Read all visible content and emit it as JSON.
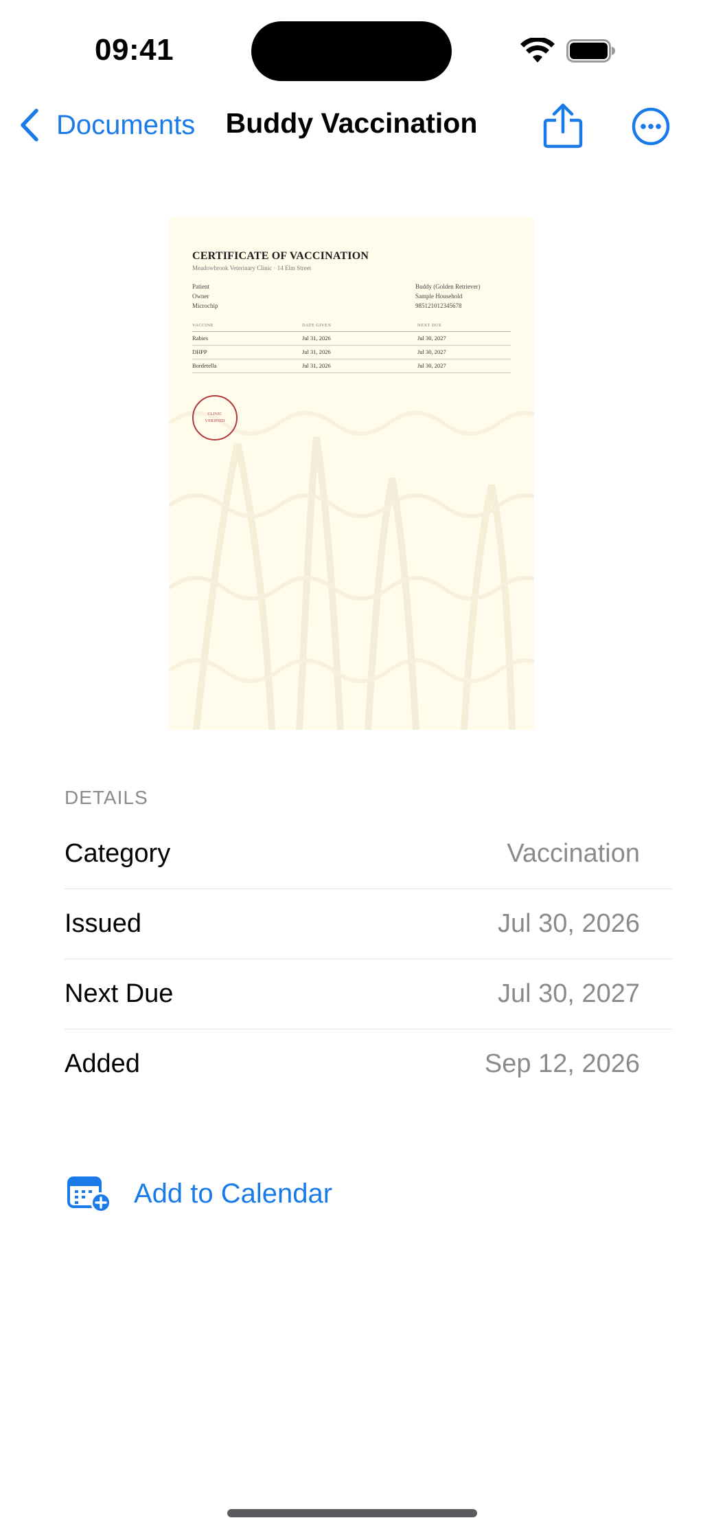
{
  "status_bar": {
    "time": "09:41",
    "wifi_icon": "wifi-icon",
    "battery_icon": "battery-icon"
  },
  "nav": {
    "back_label": "Documents",
    "title": "Buddy Vaccination",
    "share_icon": "share-icon",
    "more_icon": "ellipsis-circle-icon"
  },
  "document": {
    "title": "CERTIFICATE OF VACCINATION",
    "subtitle": "Meadowbrook Veterinary Clinic · 14 Elm Street",
    "info": [
      {
        "label": "Patient",
        "value": "Buddy (Golden Retriever)"
      },
      {
        "label": "Owner",
        "value": "Sample Household"
      },
      {
        "label": "Microchip",
        "value": "985121012345678"
      }
    ],
    "table_headers": [
      "Vaccine",
      "Date Given",
      "Next Due"
    ],
    "vaccines": [
      {
        "name": "Rabies",
        "given": "Jul 31, 2026",
        "due": "Jul 30, 2027"
      },
      {
        "name": "DHPP",
        "given": "Jul 31, 2026",
        "due": "Jul 30, 2027"
      },
      {
        "name": "Bordetella",
        "given": "Jul 31, 2026",
        "due": "Jul 30, 2027"
      }
    ],
    "stamp_line1": "CLINIC",
    "stamp_line2": "VERIFIED"
  },
  "details": {
    "header": "DETAILS",
    "rows": [
      {
        "label": "Category",
        "value": "Vaccination"
      },
      {
        "label": "Issued",
        "value": "Jul 30, 2026"
      },
      {
        "label": "Next Due",
        "value": "Jul 30, 2027"
      },
      {
        "label": "Added",
        "value": "Sep 12, 2026"
      }
    ]
  },
  "actions": {
    "add_to_calendar": "Add to Calendar",
    "calendar_icon": "calendar-add-icon"
  },
  "colors": {
    "accent": "#1a7ae8",
    "secondary_text": "#8a8a8e",
    "separator": "#e2e2e6",
    "document_paper": "#fffcec",
    "stamp": "#b03a3a"
  }
}
